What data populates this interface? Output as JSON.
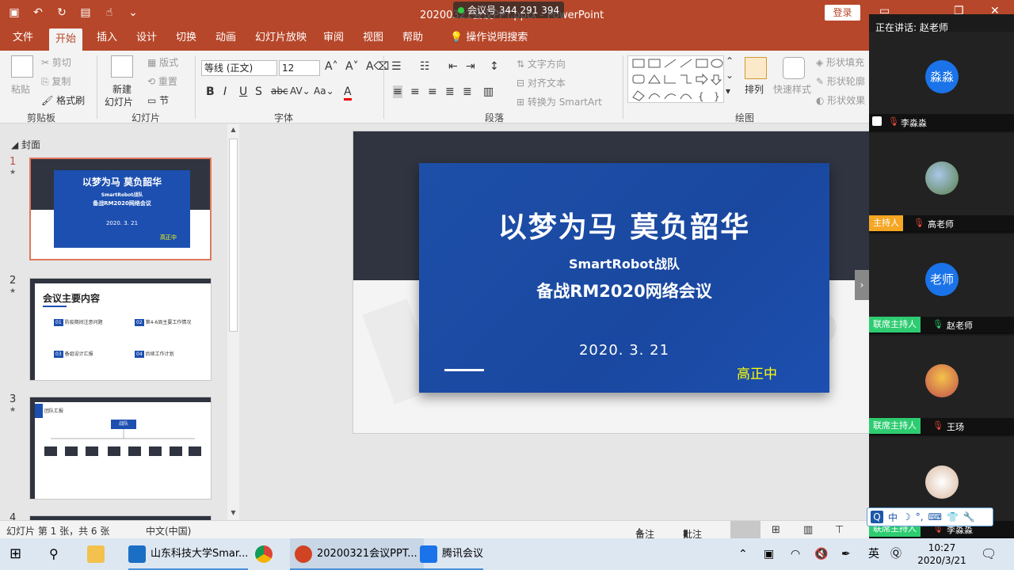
{
  "titlebar": {
    "doc_title": "20200321会议PPT.pptx - PowerPoint",
    "meeting_id": "会议号 344 291 394",
    "login": "登录"
  },
  "tabs": [
    "文件",
    "开始",
    "插入",
    "设计",
    "切换",
    "动画",
    "幻灯片放映",
    "审阅",
    "视图",
    "帮助",
    "操作说明搜索"
  ],
  "ribbon": {
    "clipboard": {
      "paste": "粘贴",
      "cut": "剪切",
      "copy": "复制",
      "format_painter": "格式刷",
      "label": "剪贴板"
    },
    "slides": {
      "new_slide": "新建\n幻灯片",
      "new_slide_l1": "新建",
      "new_slide_l2": "幻灯片",
      "layout": "版式",
      "reset": "重置",
      "section": "节",
      "label": "幻灯片"
    },
    "font": {
      "name": "等线 (正文)",
      "size": "12",
      "label": "字体"
    },
    "paragraph": {
      "text_direction": "文字方向",
      "align_text": "对齐文本",
      "smartart": "转换为 SmartArt",
      "label": "段落"
    },
    "drawing": {
      "arrange": "排列",
      "quick_styles": "快速样式",
      "shape_fill": "形状填充",
      "shape_outline": "形状轮廓",
      "shape_effects": "形状效果",
      "label": "绘图"
    }
  },
  "slide_pane": {
    "section": "封面",
    "thumbs": [
      {
        "num": "1",
        "title": "以梦为马 莫负韶华",
        "sub1": "SmartRobot战队",
        "sub2": "备战RM2020网络会议",
        "date": "2020. 3. 21",
        "author": "高正中"
      },
      {
        "num": "2",
        "title": "会议主要内容",
        "items": [
          {
            "n": "01",
            "t": "防疫期间注意问题"
          },
          {
            "n": "02",
            "t": "第4-6周主要工作情况"
          },
          {
            "n": "03",
            "t": "备组设计汇报"
          },
          {
            "n": "04",
            "t": "后续工作计划"
          }
        ]
      },
      {
        "num": "3",
        "title": "团队汇报",
        "root": "战队"
      },
      {
        "num": "4"
      }
    ]
  },
  "main_slide": {
    "title": "以梦为马 莫负韶华",
    "sub1": "SmartRobot战队",
    "sub2": "备战RM2020网络会议",
    "date": "2020. 3. 21",
    "author": "高正中"
  },
  "statusbar": {
    "slide_info": "幻灯片 第 1 张，共 6 张",
    "language": "中文(中国)",
    "notes": "备注",
    "comments": "批注"
  },
  "participants": {
    "speaking": "正在讲话: 赵老师",
    "list": [
      {
        "avatar_text": "淼淼",
        "role": "",
        "name": "李淼淼"
      },
      {
        "avatar_text": "",
        "role": "主持人",
        "name": "高老师"
      },
      {
        "avatar_text": "老师",
        "role": "联席主持人",
        "name": "赵老师"
      },
      {
        "avatar_text": "",
        "role": "联席主持人",
        "name": "王玚"
      },
      {
        "avatar_text": "",
        "role": "联席主持人",
        "name": "李淼淼"
      }
    ]
  },
  "ime": {
    "mode": "中"
  },
  "taskbar": {
    "item1": "山东科技大学Smar...",
    "item2": "20200321会议PPT...",
    "item3": "腾讯会议",
    "time": "10:27",
    "date": "2020/3/21"
  }
}
